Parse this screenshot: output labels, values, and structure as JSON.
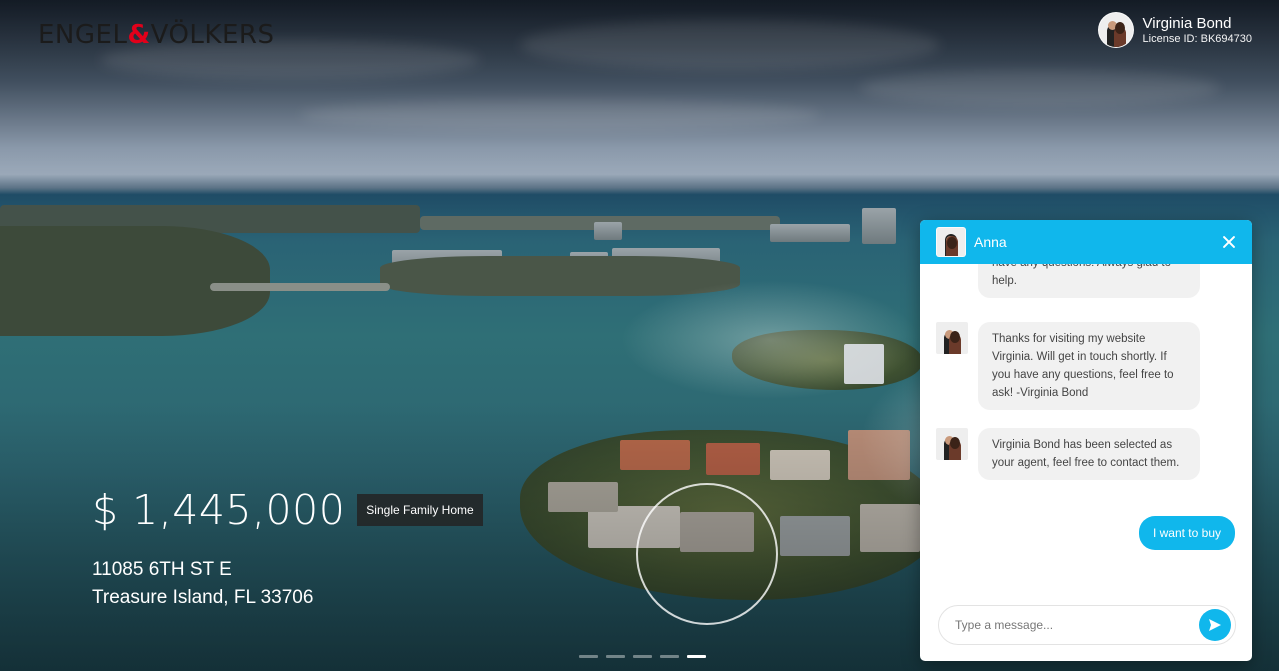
{
  "brand": {
    "left": "ENGEL",
    "amp": "&",
    "right": "VÖLKERS"
  },
  "agent": {
    "name": "Virginia Bond",
    "license": "License ID: BK694730",
    "avatar_icon": "agent-couple-avatar"
  },
  "listing": {
    "price": "$ 1,445,000",
    "property_type": "Single Family Home",
    "address_line1": "11085 6TH ST E",
    "address_line2": "Treasure Island, FL 33706"
  },
  "carousel": {
    "slides": 5,
    "active_index": 4
  },
  "chat": {
    "title": "Anna",
    "header_color": "#10b7ec",
    "messages": [
      {
        "from": "agent",
        "text": "have any questions! Always glad to help."
      },
      {
        "from": "agent",
        "text": "Thanks for visiting my website Virginia. Will get in touch shortly. If you have any questions, feel free to ask! -Virginia Bond"
      },
      {
        "from": "agent",
        "text": "Virginia Bond has been selected as your agent, feel free to contact them."
      },
      {
        "from": "user",
        "text": "I want to buy"
      }
    ],
    "input_placeholder": "Type a message...",
    "close_icon": "close-icon",
    "send_icon": "send-arrow-icon"
  }
}
